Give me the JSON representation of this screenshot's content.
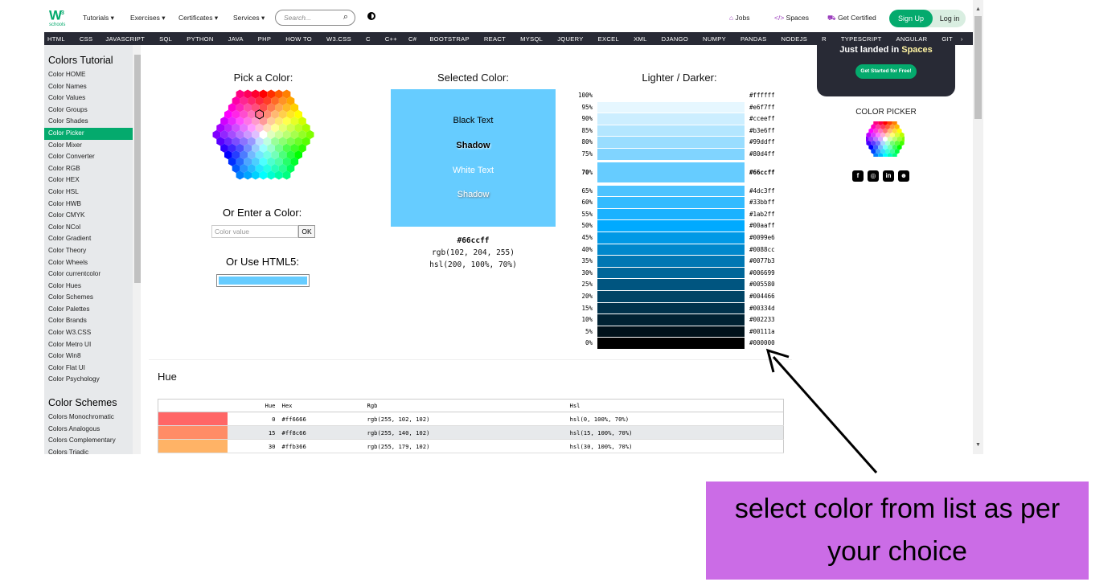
{
  "topbar": {
    "logo_w": "W",
    "logo_sup": "3",
    "logo_sub": "schools",
    "menu": [
      "Tutorials ▾",
      "Exercises ▾",
      "Certificates ▾",
      "Services ▾"
    ],
    "search_placeholder": "Search...",
    "jobs": "Jobs",
    "spaces": "Spaces",
    "certified": "Get Certified",
    "signup": "Sign Up",
    "login": "Log in"
  },
  "navbar": [
    "HTML",
    "CSS",
    "JAVASCRIPT",
    "SQL",
    "PYTHON",
    "JAVA",
    "PHP",
    "HOW TO",
    "W3.CSS",
    "C",
    "C++",
    "C#",
    "BOOTSTRAP",
    "REACT",
    "MYSQL",
    "JQUERY",
    "EXCEL",
    "XML",
    "DJANGO",
    "NUMPY",
    "PANDAS",
    "NODEJS",
    "R",
    "TYPESCRIPT",
    "ANGULAR",
    "GIT",
    "›"
  ],
  "sidebar": {
    "title": "Colors Tutorial",
    "items": [
      "Color HOME",
      "Color Names",
      "Color Values",
      "Color Groups",
      "Color Shades",
      "Color Picker",
      "Color Mixer",
      "Color Converter",
      "Color RGB",
      "Color HEX",
      "Color HSL",
      "Color HWB",
      "Color CMYK",
      "Color NCol",
      "Color Gradient",
      "Color Theory",
      "Color Wheels",
      "Color currentcolor",
      "Color Hues",
      "Color Schemes",
      "Color Palettes",
      "Color Brands",
      "Color W3.CSS",
      "Color Metro UI",
      "Color Win8",
      "Color Flat UI",
      "Color Psychology"
    ],
    "active_index": 5,
    "title2": "Color Schemes",
    "items2": [
      "Colors Monochromatic",
      "Colors Analogous",
      "Colors Complementary",
      "Colors Triadic"
    ]
  },
  "picker": {
    "pick_title": "Pick a Color:",
    "enter_title": "Or Enter a Color:",
    "input_placeholder": "Color value",
    "ok_label": "OK",
    "html5_title": "Or Use HTML5:",
    "html5_value": "#66ccff"
  },
  "selected": {
    "title": "Selected Color:",
    "color": "#66ccff",
    "black_text": "Black Text",
    "shadow1": "Shadow",
    "white_text": "White Text",
    "shadow2": "Shadow",
    "hex": "#66ccff",
    "rgb": "rgb(102, 204, 255)",
    "hsl": "hsl(200, 100%, 70%)"
  },
  "shades": {
    "title": "Lighter / Darker:",
    "rows": [
      {
        "pct": "100%",
        "hex": "#ffffff"
      },
      {
        "pct": "95%",
        "hex": "#e6f7ff"
      },
      {
        "pct": "90%",
        "hex": "#cceeff"
      },
      {
        "pct": "85%",
        "hex": "#b3e6ff"
      },
      {
        "pct": "80%",
        "hex": "#99ddff"
      },
      {
        "pct": "75%",
        "hex": "#80d4ff"
      },
      {
        "pct": "70%",
        "hex": "#66ccff"
      },
      {
        "pct": "65%",
        "hex": "#4dc3ff"
      },
      {
        "pct": "60%",
        "hex": "#33bbff"
      },
      {
        "pct": "55%",
        "hex": "#1ab2ff"
      },
      {
        "pct": "50%",
        "hex": "#00aaff"
      },
      {
        "pct": "45%",
        "hex": "#0099e6"
      },
      {
        "pct": "40%",
        "hex": "#0088cc"
      },
      {
        "pct": "35%",
        "hex": "#0077b3"
      },
      {
        "pct": "30%",
        "hex": "#006699"
      },
      {
        "pct": "25%",
        "hex": "#005580"
      },
      {
        "pct": "20%",
        "hex": "#004466"
      },
      {
        "pct": "15%",
        "hex": "#00334d"
      },
      {
        "pct": "10%",
        "hex": "#002233"
      },
      {
        "pct": "5%",
        "hex": "#00111a"
      },
      {
        "pct": "0%",
        "hex": "#000000"
      }
    ],
    "selected_index": 6
  },
  "ad": {
    "line1": "Just landed in ",
    "line1_highlight": "Spaces",
    "button": "Get Started for Free!"
  },
  "right": {
    "color_picker_title": "COLOR PICKER",
    "socials": [
      "facebook-icon",
      "instagram-icon",
      "linkedin-icon",
      "discord-icon"
    ]
  },
  "hue": {
    "title": "Hue",
    "headers": [
      "",
      "Hue",
      "Hex",
      "Rgb",
      "Hsl"
    ],
    "rows": [
      {
        "swatch": "#ff6666",
        "hue": "0",
        "hex": "#ff6666",
        "rgb": "rgb(255, 102, 102)",
        "hsl": "hsl(0, 100%, 70%)"
      },
      {
        "swatch": "#ff8c66",
        "hue": "15",
        "hex": "#ff8c66",
        "rgb": "rgb(255, 140, 102)",
        "hsl": "hsl(15, 100%, 70%)"
      },
      {
        "swatch": "#ffb366",
        "hue": "30",
        "hex": "#ffb366",
        "rgb": "rgb(255, 179, 102)",
        "hsl": "hsl(30, 100%, 70%)"
      }
    ]
  },
  "annotation": {
    "text": "select color from list as per your choice"
  }
}
